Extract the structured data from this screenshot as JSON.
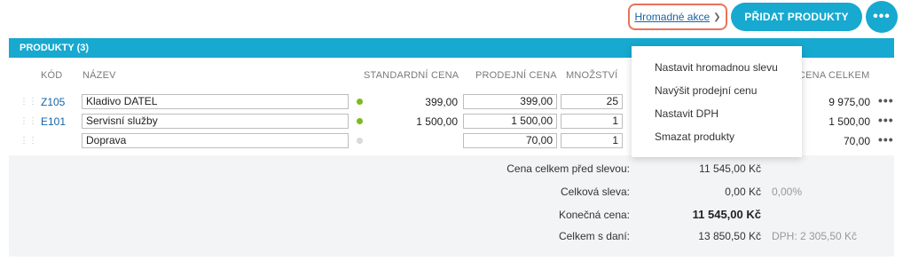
{
  "toolbar": {
    "bulk_actions_label": "Hromadné akce",
    "add_products_label": "PŘIDAT PRODUKTY",
    "more_label": "•••"
  },
  "panel": {
    "title": "PRODUKTY (3)",
    "headers": {
      "code": "KÓD",
      "name": "NÁZEV",
      "standard_price": "STANDARDNÍ CENA",
      "sale_price": "PRODEJNÍ CENA",
      "quantity": "MNOŽSTVÍ",
      "total": "CENA CELKEM"
    },
    "rows": [
      {
        "code": "Z105",
        "name": "Kladivo DATEL",
        "status_color": "#7cba1e",
        "standard_price": "399,00",
        "sale_price": "399,00",
        "quantity": "25",
        "total": "9 975,00"
      },
      {
        "code": "E101",
        "name": "Servisní služby",
        "status_color": "#7cba1e",
        "standard_price": "1 500,00",
        "sale_price": "1 500,00",
        "quantity": "1",
        "total": "1 500,00"
      },
      {
        "code": "",
        "name": "Doprava",
        "status_color": "#d9d9d9",
        "standard_price": "",
        "sale_price": "70,00",
        "quantity": "1",
        "total": "70,00"
      }
    ],
    "row_more_label": "•••"
  },
  "summary": {
    "before_discount_label": "Cena celkem před slevou:",
    "before_discount_value": "11 545,00  Kč",
    "discount_label": "Celková sleva:",
    "discount_value": "0,00  Kč",
    "discount_percent": "0,00%",
    "final_label": "Konečná cena:",
    "final_value": "11 545,00  Kč",
    "with_vat_label": "Celkem s daní:",
    "with_vat_value": "13 850,50  Kč",
    "vat_note": "DPH: 2 305,50 Kč"
  },
  "dropdown": {
    "items": [
      "Nastavit hromadnou slevu",
      "Navýšit prodejní cenu",
      "Nastavit DPH",
      "Smazat produkty"
    ]
  },
  "colors": {
    "accent": "#17a9cf",
    "highlight_border": "#e8735a",
    "link": "#1565a6"
  }
}
